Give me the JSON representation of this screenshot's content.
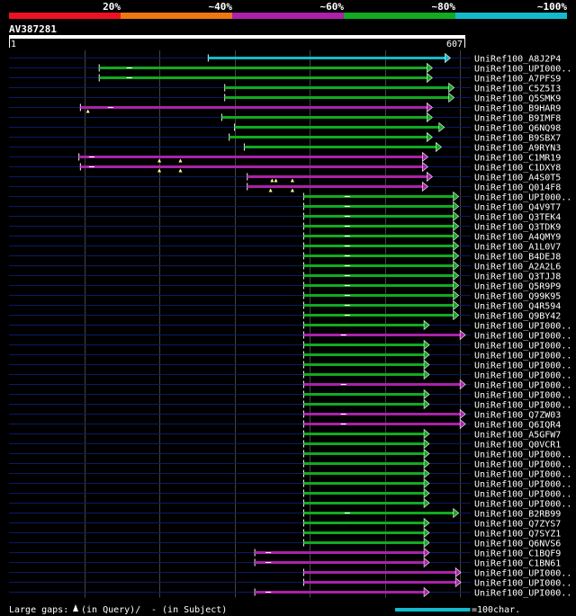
{
  "legend": {
    "labels": [
      "20%",
      "~40%",
      "~60%",
      "~80%",
      "~100%"
    ],
    "colors": [
      "#ee1122",
      "#ee7711",
      "#aa22aa",
      "#11aa22",
      "#11bbcc"
    ]
  },
  "query": {
    "name": "AV387281",
    "start_label": "1",
    "end_label": "607",
    "length": 607
  },
  "hits": [
    {
      "label": "UniRef100_A8J2P4",
      "start": 265,
      "end": 580,
      "color": "#11bbcc",
      "gaps_query": [],
      "gaps_subject": []
    },
    {
      "label": "UniRef100_UPI000..",
      "start": 120,
      "end": 556,
      "color": "#11aa22",
      "gaps_query": [],
      "gaps_subject": [
        160
      ]
    },
    {
      "label": "UniRef100_A7PFS9",
      "start": 120,
      "end": 556,
      "color": "#11aa22",
      "gaps_query": [],
      "gaps_subject": [
        160
      ]
    },
    {
      "label": "UniRef100_C5Z5I3",
      "start": 287,
      "end": 585,
      "color": "#11aa22",
      "gaps_query": [],
      "gaps_subject": []
    },
    {
      "label": "UniRef100_Q5SMK9",
      "start": 287,
      "end": 585,
      "color": "#11aa22",
      "gaps_query": [],
      "gaps_subject": []
    },
    {
      "label": "UniRef100_B9HAR9",
      "start": 95,
      "end": 556,
      "color": "#aa22aa",
      "gaps_query": [
        105
      ],
      "gaps_subject": [
        135
      ]
    },
    {
      "label": "UniRef100_B9IMF8",
      "start": 283,
      "end": 556,
      "color": "#11aa22",
      "gaps_query": [],
      "gaps_subject": []
    },
    {
      "label": "UniRef100_Q6NQ98",
      "start": 300,
      "end": 572,
      "color": "#11aa22",
      "gaps_query": [],
      "gaps_subject": []
    },
    {
      "label": "UniRef100_B9SBX7",
      "start": 293,
      "end": 556,
      "color": "#11aa22",
      "gaps_query": [],
      "gaps_subject": []
    },
    {
      "label": "UniRef100_A9RYN3",
      "start": 313,
      "end": 568,
      "color": "#11aa22",
      "gaps_query": [],
      "gaps_subject": []
    },
    {
      "label": "UniRef100_C1MR19",
      "start": 93,
      "end": 550,
      "color": "#aa22aa",
      "gaps_query": [
        200,
        228
      ],
      "gaps_subject": [
        110
      ]
    },
    {
      "label": "UniRef100_C1DXY8",
      "start": 95,
      "end": 550,
      "color": "#aa22aa",
      "gaps_query": [
        200,
        228
      ],
      "gaps_subject": [
        110
      ]
    },
    {
      "label": "UniRef100_A4S0T5",
      "start": 317,
      "end": 556,
      "color": "#aa22aa",
      "gaps_query": [
        350,
        355,
        377
      ],
      "gaps_subject": []
    },
    {
      "label": "UniRef100_Q014F8",
      "start": 317,
      "end": 550,
      "color": "#aa22aa",
      "gaps_query": [
        348,
        377
      ],
      "gaps_subject": []
    },
    {
      "label": "UniRef100_UPI000..",
      "start": 392,
      "end": 591,
      "color": "#11aa22",
      "gaps_query": [],
      "gaps_subject": [
        450
      ]
    },
    {
      "label": "UniRef100_Q4V9T7",
      "start": 392,
      "end": 591,
      "color": "#11aa22",
      "gaps_query": [],
      "gaps_subject": [
        450
      ]
    },
    {
      "label": "UniRef100_Q3TEK4",
      "start": 392,
      "end": 591,
      "color": "#11aa22",
      "gaps_query": [],
      "gaps_subject": [
        450
      ]
    },
    {
      "label": "UniRef100_Q3TDK9",
      "start": 392,
      "end": 591,
      "color": "#11aa22",
      "gaps_query": [],
      "gaps_subject": [
        450
      ]
    },
    {
      "label": "UniRef100_A4QMY9",
      "start": 392,
      "end": 591,
      "color": "#11aa22",
      "gaps_query": [],
      "gaps_subject": [
        450
      ]
    },
    {
      "label": "UniRef100_A1L0V7",
      "start": 392,
      "end": 591,
      "color": "#11aa22",
      "gaps_query": [],
      "gaps_subject": [
        450
      ]
    },
    {
      "label": "UniRef100_B4DEJ8",
      "start": 392,
      "end": 591,
      "color": "#11aa22",
      "gaps_query": [],
      "gaps_subject": [
        450
      ]
    },
    {
      "label": "UniRef100_A2A2L6",
      "start": 392,
      "end": 591,
      "color": "#11aa22",
      "gaps_query": [],
      "gaps_subject": [
        450
      ]
    },
    {
      "label": "UniRef100_Q3TJJ8",
      "start": 392,
      "end": 591,
      "color": "#11aa22",
      "gaps_query": [],
      "gaps_subject": [
        450
      ]
    },
    {
      "label": "UniRef100_Q5R9P9",
      "start": 392,
      "end": 591,
      "color": "#11aa22",
      "gaps_query": [],
      "gaps_subject": [
        450
      ]
    },
    {
      "label": "UniRef100_Q99K95",
      "start": 392,
      "end": 591,
      "color": "#11aa22",
      "gaps_query": [],
      "gaps_subject": [
        450
      ]
    },
    {
      "label": "UniRef100_Q4R594",
      "start": 392,
      "end": 591,
      "color": "#11aa22",
      "gaps_query": [],
      "gaps_subject": [
        450
      ]
    },
    {
      "label": "UniRef100_Q9BY42",
      "start": 392,
      "end": 591,
      "color": "#11aa22",
      "gaps_query": [],
      "gaps_subject": [
        450
      ]
    },
    {
      "label": "UniRef100_UPI000..",
      "start": 392,
      "end": 552,
      "color": "#11aa22",
      "gaps_query": [],
      "gaps_subject": []
    },
    {
      "label": "UniRef100_UPI000..",
      "start": 392,
      "end": 600,
      "color": "#aa22aa",
      "gaps_query": [],
      "gaps_subject": [
        445
      ]
    },
    {
      "label": "UniRef100_UPI000..",
      "start": 392,
      "end": 552,
      "color": "#11aa22",
      "gaps_query": [],
      "gaps_subject": []
    },
    {
      "label": "UniRef100_UPI000..",
      "start": 392,
      "end": 552,
      "color": "#11aa22",
      "gaps_query": [],
      "gaps_subject": []
    },
    {
      "label": "UniRef100_UPI000..",
      "start": 392,
      "end": 552,
      "color": "#11aa22",
      "gaps_query": [],
      "gaps_subject": []
    },
    {
      "label": "UniRef100_UPI000..",
      "start": 392,
      "end": 552,
      "color": "#11aa22",
      "gaps_query": [],
      "gaps_subject": []
    },
    {
      "label": "UniRef100_UPI000..",
      "start": 392,
      "end": 600,
      "color": "#aa22aa",
      "gaps_query": [],
      "gaps_subject": [
        445
      ]
    },
    {
      "label": "UniRef100_UPI000..",
      "start": 392,
      "end": 552,
      "color": "#11aa22",
      "gaps_query": [],
      "gaps_subject": []
    },
    {
      "label": "UniRef100_UPI000..",
      "start": 392,
      "end": 552,
      "color": "#11aa22",
      "gaps_query": [],
      "gaps_subject": []
    },
    {
      "label": "UniRef100_Q7ZW03",
      "start": 392,
      "end": 600,
      "color": "#aa22aa",
      "gaps_query": [],
      "gaps_subject": [
        445
      ]
    },
    {
      "label": "UniRef100_Q6IQR4",
      "start": 392,
      "end": 600,
      "color": "#aa22aa",
      "gaps_query": [],
      "gaps_subject": [
        445
      ]
    },
    {
      "label": "UniRef100_A5GFW7",
      "start": 392,
      "end": 552,
      "color": "#11aa22",
      "gaps_query": [],
      "gaps_subject": []
    },
    {
      "label": "UniRef100_Q0VCR1",
      "start": 392,
      "end": 552,
      "color": "#11aa22",
      "gaps_query": [],
      "gaps_subject": []
    },
    {
      "label": "UniRef100_UPI000..",
      "start": 392,
      "end": 552,
      "color": "#11aa22",
      "gaps_query": [],
      "gaps_subject": []
    },
    {
      "label": "UniRef100_UPI000..",
      "start": 392,
      "end": 552,
      "color": "#11aa22",
      "gaps_query": [],
      "gaps_subject": []
    },
    {
      "label": "UniRef100_UPI000..",
      "start": 392,
      "end": 552,
      "color": "#11aa22",
      "gaps_query": [],
      "gaps_subject": []
    },
    {
      "label": "UniRef100_UPI000..",
      "start": 392,
      "end": 552,
      "color": "#11aa22",
      "gaps_query": [],
      "gaps_subject": []
    },
    {
      "label": "UniRef100_UPI000..",
      "start": 392,
      "end": 552,
      "color": "#11aa22",
      "gaps_query": [],
      "gaps_subject": []
    },
    {
      "label": "UniRef100_UPI000..",
      "start": 392,
      "end": 552,
      "color": "#11aa22",
      "gaps_query": [],
      "gaps_subject": []
    },
    {
      "label": "UniRef100_B2RB99",
      "start": 392,
      "end": 591,
      "color": "#11aa22",
      "gaps_query": [],
      "gaps_subject": [
        450
      ]
    },
    {
      "label": "UniRef100_Q7ZYS7",
      "start": 392,
      "end": 552,
      "color": "#11aa22",
      "gaps_query": [],
      "gaps_subject": []
    },
    {
      "label": "UniRef100_Q7SYZ1",
      "start": 392,
      "end": 552,
      "color": "#11aa22",
      "gaps_query": [],
      "gaps_subject": []
    },
    {
      "label": "UniRef100_Q6NVS6",
      "start": 392,
      "end": 552,
      "color": "#11aa22",
      "gaps_query": [],
      "gaps_subject": []
    },
    {
      "label": "UniRef100_C1BQF9",
      "start": 327,
      "end": 552,
      "color": "#aa22aa",
      "gaps_query": [],
      "gaps_subject": [
        345
      ]
    },
    {
      "label": "UniRef100_C1BN61",
      "start": 327,
      "end": 552,
      "color": "#aa22aa",
      "gaps_query": [],
      "gaps_subject": [
        345
      ]
    },
    {
      "label": "UniRef100_UPI000..",
      "start": 392,
      "end": 594,
      "color": "#aa22aa",
      "gaps_query": [],
      "gaps_subject": []
    },
    {
      "label": "UniRef100_UPI000..",
      "start": 392,
      "end": 594,
      "color": "#aa22aa",
      "gaps_query": [],
      "gaps_subject": []
    },
    {
      "label": "UniRef100_UPI000..",
      "start": 327,
      "end": 552,
      "color": "#aa22aa",
      "gaps_query": [],
      "gaps_subject": [
        345
      ]
    }
  ],
  "footer": {
    "gaps_prefix": "Large gaps: ",
    "gaps_query": "(in Query)/",
    "gaps_subject": "- (in Subject)",
    "scale_label": "=100char.",
    "scale_chars": 100,
    "scale_color": "#11bbcc"
  }
}
